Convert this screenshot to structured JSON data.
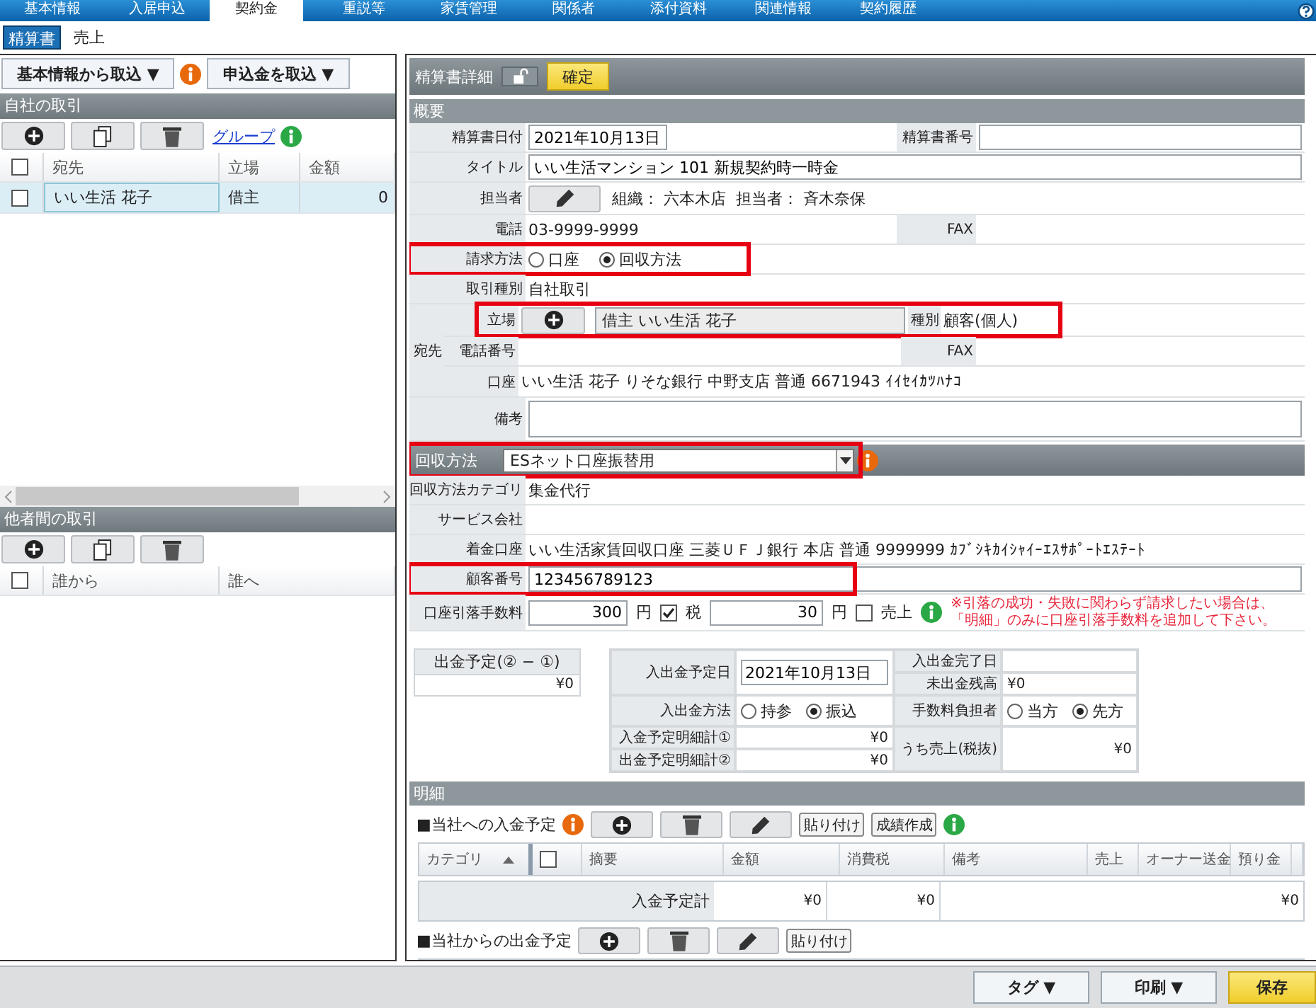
{
  "tabs": [
    {
      "label": "基本情報",
      "selected": false
    },
    {
      "label": "入居申込",
      "selected": false
    },
    {
      "label": "契約金",
      "selected": true
    },
    {
      "label": "重説等",
      "selected": false
    },
    {
      "label": "家賃管理",
      "selected": false
    },
    {
      "label": "関係者",
      "selected": false
    },
    {
      "label": "添付資料",
      "selected": false
    },
    {
      "label": "関連情報",
      "selected": false
    },
    {
      "label": "契約履歴",
      "selected": false
    }
  ],
  "subtabs": [
    {
      "label": "精算書",
      "selected": true
    },
    {
      "label": "売上",
      "selected": false
    }
  ],
  "left": {
    "import_buttons": [
      "基本情報から取込 ▼",
      "申込金を取込 ▼"
    ],
    "own": {
      "title": "自社の取引",
      "group_link": "グループ",
      "header_checked": false,
      "columns": [
        "宛先",
        "立場",
        "金額"
      ],
      "rows": [
        {
          "cells": [
            "いい生活 花子",
            "借主",
            "0"
          ],
          "checked": false,
          "selected": true
        }
      ]
    },
    "others": {
      "title": "他者間の取引",
      "header_checked": false,
      "columns": [
        "誰から",
        "誰へ"
      ]
    }
  },
  "detail": {
    "title": "精算書詳細",
    "confirm": "確定",
    "section": "概要",
    "rows": [
      {
        "kind": "field2",
        "label": "精算書日付",
        "value": "2021年10月13日",
        "label2": "精算書番号"
      },
      {
        "kind": "field",
        "label": "タイトル",
        "value": "いい生活マンション 101 新規契約時一時金"
      },
      {
        "kind": "staff",
        "label": "担当者",
        "value": "組織： 六本木店  担当者： 斉木奈保"
      },
      {
        "kind": "text2",
        "label": "電話",
        "value": "03-9999-9999",
        "label2": "FAX"
      },
      {
        "kind": "radio",
        "label": "請求方法",
        "highlighted": true,
        "options": [
          {
            "label": "口座",
            "selected": false
          },
          {
            "label": "回収方法",
            "selected": true
          }
        ]
      },
      {
        "kind": "text",
        "label": "取引種別",
        "value": "自社取引"
      },
      {
        "kind": "group",
        "label": "宛先",
        "rows": [
          {
            "kind": "party",
            "label": "立場",
            "value": "借主 いい生活 花子",
            "label2": "種別",
            "value2": "顧客(個人)",
            "highlighted": true
          },
          {
            "kind": "text2",
            "label": "電話番号",
            "label2": "FAX"
          },
          {
            "kind": "text",
            "label": "口座",
            "value": "いい生活 花子 りそな銀行  中野支店  普通  6671943  ｲｲｾｲｶﾂﾊﾅｺ"
          }
        ]
      },
      {
        "kind": "memo",
        "label": "備考"
      }
    ],
    "collection": {
      "label": "回収方法",
      "value": "ESネット口座振替用",
      "highlighted": true,
      "rows": [
        {
          "kind": "text",
          "label": "回収方法カテゴリ",
          "value": "集金代行"
        },
        {
          "kind": "text",
          "label": "サービス会社"
        },
        {
          "kind": "text",
          "label": "着金口座",
          "value": "いい生活家賃回収口座 三菱ＵＦＪ銀行  本店  普通  9999999  ｶﾌﾞｼｷｶｲｼｬｲｰｴｽｻﾎﾟｰﾄｴｽﾃｰﾄ"
        },
        {
          "kind": "field",
          "label": "顧客番号",
          "value": "123456789123",
          "highlighted": true
        },
        {
          "kind": "fee",
          "label": "口座引落手数料",
          "amount": "300",
          "unit": "円",
          "tax_checked": true,
          "tax_label": "税",
          "tax_amount": "30",
          "unit2": "円",
          "sales_checked": false,
          "sales_label": "売上",
          "note": [
            "※引落の成功・失敗に関わらず請求したい場合は、",
            "「明細」のみに口座引落手数料を追加して下さい。"
          ]
        }
      ]
    },
    "balance": {
      "label": "出金予定(② − ①)",
      "value": "¥0"
    },
    "schedule": {
      "date_label": "入出金予定日",
      "date": "2021年10月13日",
      "done_label": "入出金完了日",
      "unpaid_label": "未出金残高",
      "unpaid": "¥0",
      "method_label": "入出金方法",
      "methods": [
        {
          "label": "持参",
          "selected": false
        },
        {
          "label": "振込",
          "selected": true
        }
      ],
      "payer_label": "手数料負担者",
      "payers": [
        {
          "label": "当方",
          "selected": false
        },
        {
          "label": "先方",
          "selected": true
        }
      ],
      "in_label": "入金予定明細計①",
      "in_total": "¥0",
      "out_label": "出金予定明細計②",
      "out_total": "¥0",
      "sales_label": "うち売上(税抜)",
      "sales": "¥0"
    },
    "items": {
      "title": "明細",
      "incoming": {
        "title": "■当社への入金予定",
        "header_checked": false,
        "buttons": [
          {
            "kind": "add"
          },
          {
            "kind": "delete"
          },
          {
            "kind": "edit"
          },
          {
            "kind": "text",
            "label": "貼り付け"
          },
          {
            "kind": "text",
            "label": "成績作成"
          }
        ],
        "columns": [
          "カテゴリ",
          "摘要",
          "金額",
          "消費税",
          "備考",
          "売上",
          "オーナー送金",
          "預り金"
        ],
        "total": {
          "label": "入金予定計",
          "values": [
            "¥0",
            "¥0",
            "¥0"
          ]
        }
      },
      "outgoing": {
        "title": "■当社からの出金予定",
        "buttons": [
          {
            "kind": "add"
          },
          {
            "kind": "delete"
          },
          {
            "kind": "edit"
          },
          {
            "kind": "text",
            "label": "貼り付け"
          }
        ]
      }
    }
  },
  "footer": {
    "buttons": [
      {
        "label": "タグ ▼",
        "kind": "menu"
      },
      {
        "label": "印刷 ▼",
        "kind": "menu"
      },
      {
        "label": "保存",
        "kind": "primary"
      }
    ]
  }
}
